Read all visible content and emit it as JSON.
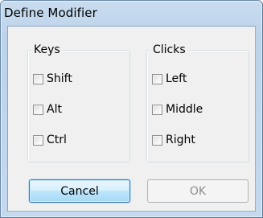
{
  "window": {
    "title": "Define Modifier"
  },
  "keys_group": {
    "legend": "Keys",
    "options": [
      {
        "label": "Shift",
        "checked": false
      },
      {
        "label": "Alt",
        "checked": false
      },
      {
        "label": "Ctrl",
        "checked": false
      }
    ]
  },
  "clicks_group": {
    "legend": "Clicks",
    "options": [
      {
        "label": "Left",
        "checked": false
      },
      {
        "label": "Middle",
        "checked": false
      },
      {
        "label": "Right",
        "checked": false
      }
    ]
  },
  "buttons": {
    "cancel_label": "Cancel",
    "ok_label": "OK",
    "ok_enabled": false
  },
  "colors": {
    "title_gradient": "#c4d9ee",
    "client_bg": "#f0f0f0",
    "cancel_border": "#3c7fb1",
    "disabled_text": "#8d8d8d"
  }
}
